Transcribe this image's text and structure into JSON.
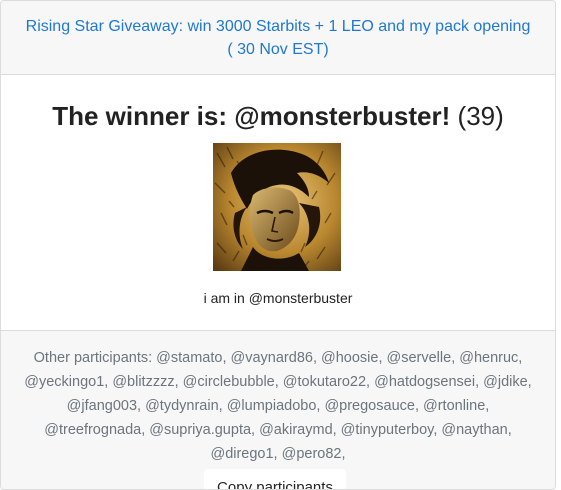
{
  "header": {
    "link_text": "Rising Star Giveaway: win 3000 Starbits + 1 LEO and my pack opening ( 30 Nov EST)"
  },
  "winner": {
    "prefix": "The winner is: ",
    "name": "@monsterbuster!",
    "count": "(39)",
    "note": "i am in @monsterbuster"
  },
  "footer": {
    "participants_text": "Other participants: @stamato, @vaynard86, @hoosie, @servelle, @henruc, @yeckingo1, @blitzzzz, @circlebubble, @tokutaro22, @hatdogsensei, @jdike, @jfang003, @tydynrain, @lumpiadobo, @pregosauce, @rtonline, @treefrognada, @supriya.gupta, @akiraymd, @tinyputerboy, @naythan, @dirego1, @pero82,",
    "copy_button_label": "Copy participants"
  },
  "colors": {
    "link": "#1f78d1",
    "muted_text": "#6c757d",
    "panel_background": "#f7f7f7",
    "border": "#dcdcdc"
  }
}
